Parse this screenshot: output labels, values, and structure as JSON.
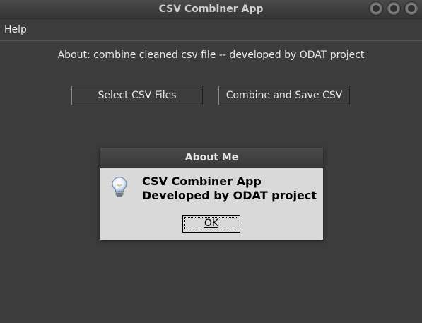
{
  "window": {
    "title": "CSV Combiner App"
  },
  "menu": {
    "help": "Help"
  },
  "main": {
    "about_text": "About: combine cleaned csv file -- developed by ODAT project",
    "select_button": "Select CSV Files",
    "combine_button": "Combine and Save CSV"
  },
  "dialog": {
    "title": "About Me",
    "line1": "CSV Combiner App",
    "line2": "Developed by ODAT project",
    "ok": "OK",
    "icon": "lightbulb-icon"
  }
}
